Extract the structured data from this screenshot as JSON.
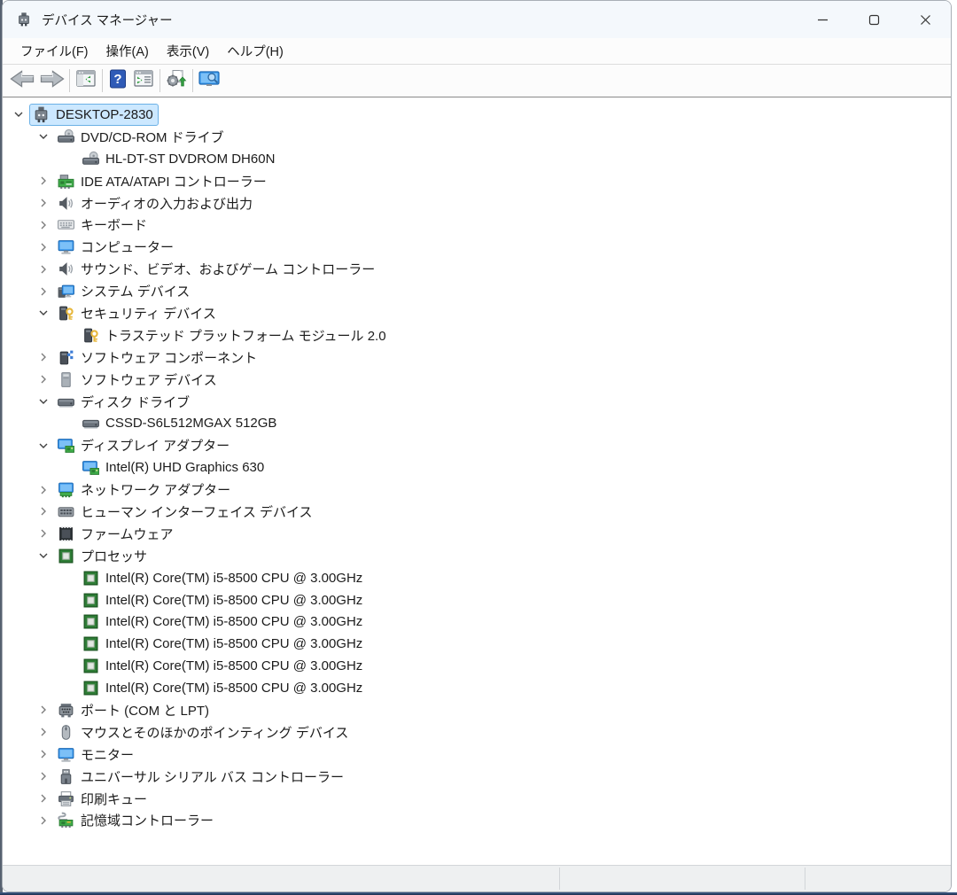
{
  "window": {
    "title": "デバイス マネージャー",
    "controls": [
      "minimize",
      "maximize",
      "close"
    ]
  },
  "menu": {
    "items": [
      "ファイル(F)",
      "操作(A)",
      "表示(V)",
      "ヘルプ(H)"
    ]
  },
  "toolbar": {
    "buttons": [
      "back",
      "forward",
      "show-console-tree",
      "help",
      "properties",
      "scan-hardware-changes",
      "device-search"
    ]
  },
  "tree": {
    "items": [
      {
        "label": "DESKTOP-2830",
        "icon": "device-manager",
        "level": 0,
        "state": "expanded",
        "selected": true
      },
      {
        "label": "DVD/CD-ROM ドライブ",
        "icon": "cdrom-drive",
        "level": 1,
        "state": "expanded"
      },
      {
        "label": "HL-DT-ST DVDROM DH60N",
        "icon": "cdrom-drive",
        "level": 2,
        "state": "leaf"
      },
      {
        "label": "IDE ATA/ATAPI コントローラー",
        "icon": "ide-controller",
        "level": 1,
        "state": "collapsed"
      },
      {
        "label": "オーディオの入力および出力",
        "icon": "audio-device",
        "level": 1,
        "state": "collapsed"
      },
      {
        "label": "キーボード",
        "icon": "keyboard",
        "level": 1,
        "state": "collapsed"
      },
      {
        "label": "コンピューター",
        "icon": "computer",
        "level": 1,
        "state": "collapsed"
      },
      {
        "label": "サウンド、ビデオ、およびゲーム コントローラー",
        "icon": "sound-controller",
        "level": 1,
        "state": "collapsed"
      },
      {
        "label": "システム デバイス",
        "icon": "system-device",
        "level": 1,
        "state": "collapsed"
      },
      {
        "label": "セキュリティ デバイス",
        "icon": "security-device",
        "level": 1,
        "state": "expanded"
      },
      {
        "label": "トラステッド プラットフォーム モジュール 2.0",
        "icon": "security-device",
        "level": 2,
        "state": "leaf"
      },
      {
        "label": "ソフトウェア コンポーネント",
        "icon": "software-component",
        "level": 1,
        "state": "collapsed"
      },
      {
        "label": "ソフトウェア デバイス",
        "icon": "software-device",
        "level": 1,
        "state": "collapsed"
      },
      {
        "label": "ディスク ドライブ",
        "icon": "disk-drive",
        "level": 1,
        "state": "expanded"
      },
      {
        "label": "CSSD-S6L512MGAX 512GB",
        "icon": "disk-drive",
        "level": 2,
        "state": "leaf"
      },
      {
        "label": "ディスプレイ アダプター",
        "icon": "display-adapter",
        "level": 1,
        "state": "expanded"
      },
      {
        "label": "Intel(R) UHD Graphics 630",
        "icon": "display-adapter",
        "level": 2,
        "state": "leaf"
      },
      {
        "label": "ネットワーク アダプター",
        "icon": "network-adapter",
        "level": 1,
        "state": "collapsed"
      },
      {
        "label": "ヒューマン インターフェイス デバイス",
        "icon": "hid-device",
        "level": 1,
        "state": "collapsed"
      },
      {
        "label": "ファームウェア",
        "icon": "firmware",
        "level": 1,
        "state": "collapsed"
      },
      {
        "label": "プロセッサ",
        "icon": "processor",
        "level": 1,
        "state": "expanded"
      },
      {
        "label": "Intel(R) Core(TM) i5-8500 CPU @ 3.00GHz",
        "icon": "processor",
        "level": 2,
        "state": "leaf"
      },
      {
        "label": "Intel(R) Core(TM) i5-8500 CPU @ 3.00GHz",
        "icon": "processor",
        "level": 2,
        "state": "leaf"
      },
      {
        "label": "Intel(R) Core(TM) i5-8500 CPU @ 3.00GHz",
        "icon": "processor",
        "level": 2,
        "state": "leaf"
      },
      {
        "label": "Intel(R) Core(TM) i5-8500 CPU @ 3.00GHz",
        "icon": "processor",
        "level": 2,
        "state": "leaf"
      },
      {
        "label": "Intel(R) Core(TM) i5-8500 CPU @ 3.00GHz",
        "icon": "processor",
        "level": 2,
        "state": "leaf"
      },
      {
        "label": "Intel(R) Core(TM) i5-8500 CPU @ 3.00GHz",
        "icon": "processor",
        "level": 2,
        "state": "leaf"
      },
      {
        "label": "ポート (COM と LPT)",
        "icon": "port",
        "level": 1,
        "state": "collapsed"
      },
      {
        "label": "マウスとそのほかのポインティング デバイス",
        "icon": "mouse",
        "level": 1,
        "state": "collapsed"
      },
      {
        "label": "モニター",
        "icon": "monitor",
        "level": 1,
        "state": "collapsed"
      },
      {
        "label": "ユニバーサル シリアル バス コントローラー",
        "icon": "usb-controller",
        "level": 1,
        "state": "collapsed"
      },
      {
        "label": "印刷キュー",
        "icon": "print-queue",
        "level": 1,
        "state": "collapsed"
      },
      {
        "label": "記憶域コントローラー",
        "icon": "storage-controller",
        "level": 1,
        "state": "collapsed"
      }
    ]
  },
  "statusbar": {
    "sections": [
      "",
      "",
      ""
    ]
  },
  "colors": {
    "selection_fill": "#cce8ff",
    "selection_border": "#6cb1e6",
    "titlebar": "#f4f8fc",
    "accent_blue": "#3b9af0",
    "accent_green": "#3fae49"
  }
}
